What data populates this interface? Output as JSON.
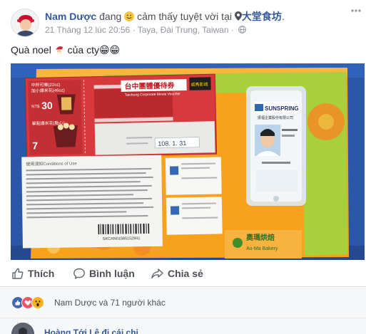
{
  "post": {
    "author": "Nam Dược",
    "status_verb": "đang",
    "feeling": "cảm thấy tuyệt vời tại",
    "place": "大堂食坊",
    "place_suffix": ".",
    "timestamp": "21 Tháng 12 lúc 20:56",
    "location": "Taya, Đài Trung, Taiwan",
    "separator": "·",
    "text_before": "Quà noel",
    "text_after": "của cty😁😁"
  },
  "photo": {
    "ticket_title": "台中團體優待券",
    "ticket_subtitle": "Taichung Corporate Movie Voucher",
    "ticket_brand": "威秀影城",
    "ticket_expiry": "108. 1. 31",
    "combo_line1": "中杯可樂(22oz)",
    "combo_line2": "加小爆米花(46oz)",
    "combo_price_label": "NT$",
    "combo_price": "30",
    "combo_line3": "單點爆米花(點心)",
    "combo_price2": "7",
    "notes_title": "使用須知",
    "notes_title_en": "Conditions of Use",
    "barcode_number": "SKCAN01585152941",
    "box_brand": "奧瑪烘焙",
    "box_brand_en": "Au-Ma Bakery",
    "badge_company": "SUNSPRING",
    "badge_company_cn": "振福企業股份有限公司"
  },
  "actions": {
    "like": "Thích",
    "comment": "Bình luận",
    "share": "Chia sẻ"
  },
  "reactions": {
    "summary": "Nam Dược và 71 người khác"
  },
  "comment": {
    "preview": "Hoàng Tới Lê đi cái chi"
  },
  "colors": {
    "link": "#365899",
    "like_blue": "#4267b2",
    "love_red": "#f25268",
    "wow_yellow": "#f7b125",
    "photo_bg": "#2a57a8",
    "folder_orange": "#f6a21d",
    "ticket_red": "#d63a3c"
  },
  "icons": {
    "avatar": "avatar-icon",
    "feeling": "smile-emoji-icon",
    "pin": "location-pin-icon",
    "globe": "globe-icon",
    "more": "more-options-icon",
    "like": "thumbs-up-icon",
    "comment": "speech-bubble-icon",
    "share": "share-arrow-icon"
  }
}
